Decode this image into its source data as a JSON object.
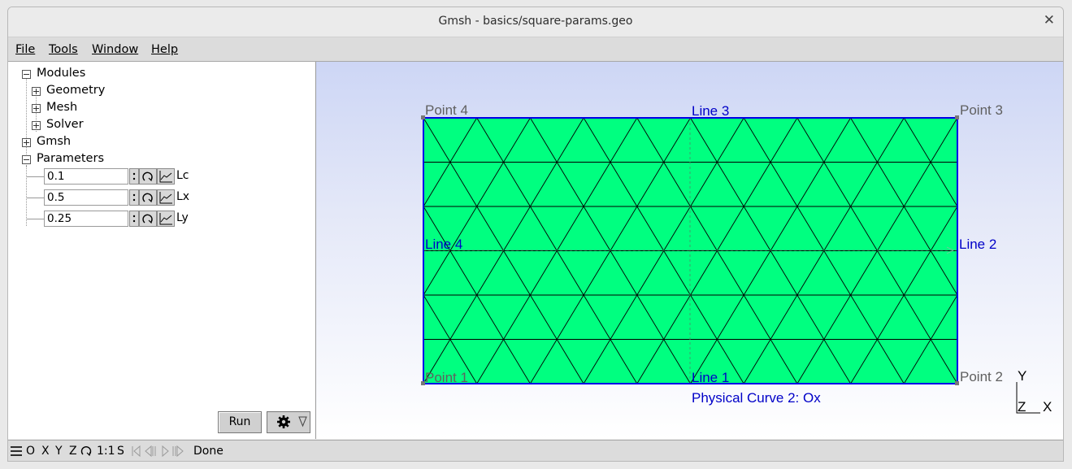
{
  "window": {
    "title": "Gmsh - basics/square-params.geo",
    "close_glyph": "✕"
  },
  "menu": {
    "file": "File",
    "tools": "Tools",
    "window": "Window",
    "help": "Help"
  },
  "tree": {
    "modules": "Modules",
    "geometry": "Geometry",
    "mesh": "Mesh",
    "solver": "Solver",
    "gmsh": "Gmsh",
    "parameters": "Parameters"
  },
  "params": [
    {
      "value": "0.1",
      "label": "Lc"
    },
    {
      "value": "0.5",
      "label": "Lx"
    },
    {
      "value": "0.25",
      "label": "Ly"
    }
  ],
  "buttons": {
    "run": "Run",
    "options_icon": "gear-icon"
  },
  "graphics": {
    "point1": "Point 1",
    "point2": "Point 2",
    "point3": "Point 3",
    "point4": "Point 4",
    "line1": "Line 1",
    "line2": "Line 2",
    "line3": "Line 3",
    "line4": "Line 4",
    "physical": "Physical Curve 2: Ox",
    "axis_y": "Y",
    "axis_z": "Z",
    "axis_x": "X",
    "mesh_color": "#00ff80",
    "boundary_color": "#0000e6"
  },
  "status": {
    "o": "O",
    "x": "X",
    "y": "Y",
    "z": "Z",
    "scale": "1:1",
    "s": "S",
    "message": "Done"
  }
}
